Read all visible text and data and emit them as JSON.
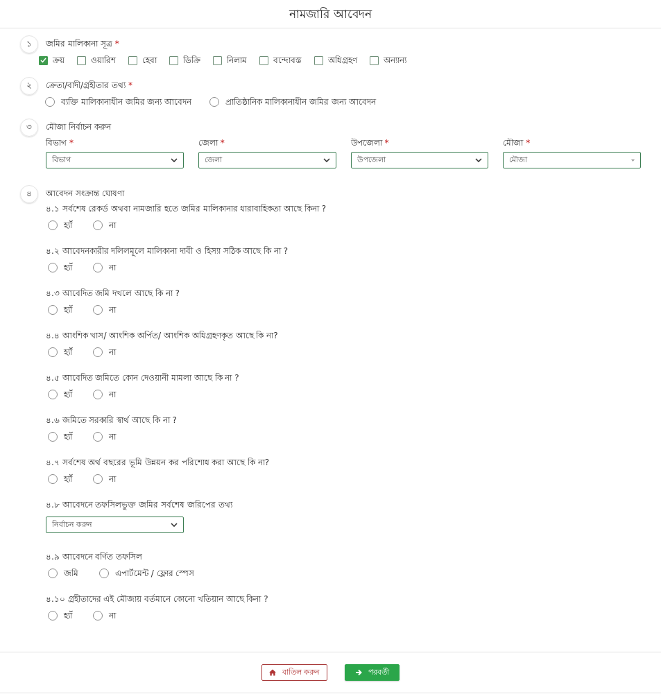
{
  "header": {
    "title": "নামজারি আবেদন"
  },
  "sections": [
    {
      "number": "১",
      "kind": "checkboxes",
      "label": "জমির মালিকানা সূত্র",
      "required_mark": "*",
      "options": [
        {
          "label": "ক্রয়",
          "checked": true
        },
        {
          "label": "ওয়ারিশ",
          "checked": false
        },
        {
          "label": "হেবা",
          "checked": false
        },
        {
          "label": "ডিক্রি",
          "checked": false
        },
        {
          "label": "নিলাম",
          "checked": false
        },
        {
          "label": "বন্দোবস্ত",
          "checked": false
        },
        {
          "label": "অধিগ্রহণ",
          "checked": false
        },
        {
          "label": "অন্যান্য",
          "checked": false
        }
      ]
    },
    {
      "number": "২",
      "kind": "radios",
      "label": "ক্রেতা/বাদী/গ্রহীতার তথ্য",
      "required_mark": "*",
      "options": [
        {
          "label": "ব্যক্তি মালিকানাধীন জমির জন্য আবেদন",
          "selected": false
        },
        {
          "label": "প্রাতিষ্ঠানিক মালিকানাধীন জমির জন্য আবেদন",
          "selected": false
        }
      ]
    },
    {
      "number": "৩",
      "kind": "selects",
      "label": "মৌজা নির্বাচন করুন",
      "fields": [
        {
          "kind": "dropdown",
          "label": "বিভাগ",
          "required_mark": "*",
          "placeholder": "বিভাগ"
        },
        {
          "kind": "dropdown",
          "label": "জেলা",
          "required_mark": "*",
          "placeholder": "জেলা"
        },
        {
          "kind": "dropdown",
          "label": "উপজেলা",
          "required_mark": "*",
          "placeholder": "উপজেলা"
        },
        {
          "kind": "combobox",
          "label": "মৌজা",
          "required_mark": "*",
          "placeholder": "মৌজা"
        }
      ]
    },
    {
      "number": "৪",
      "kind": "questions",
      "label": "আবেদন সংক্রান্ত ঘোষণা",
      "questions": [
        {
          "kind": "radios",
          "text": "৪.১ সর্বশেষ রেকর্ড অথবা নামজারি হতে জমির মালিকানার ধারাবাহিকতা আছে কিনা ?",
          "options": [
            {
              "label": "হ্যাঁ",
              "selected": false
            },
            {
              "label": "না",
              "selected": false
            }
          ]
        },
        {
          "kind": "radios",
          "text": "৪.২ আবেদনকারীর দলিলমূলে মালিকানা দাবী ও হিস্যা সঠিক আছে কি না ?",
          "options": [
            {
              "label": "হ্যাঁ",
              "selected": false
            },
            {
              "label": "না",
              "selected": false
            }
          ]
        },
        {
          "kind": "radios",
          "text": "৪.৩ আবেদিত জমি দখলে আছে কি না ?",
          "options": [
            {
              "label": "হ্যাঁ",
              "selected": false
            },
            {
              "label": "না",
              "selected": false
            }
          ]
        },
        {
          "kind": "radios",
          "text": "৪.৪ আংশিক খাস/ আংশিক অর্পিত/ আংশিক অধিগ্রহণকৃত আছে কি না?",
          "options": [
            {
              "label": "হ্যাঁ",
              "selected": false
            },
            {
              "label": "না",
              "selected": false
            }
          ]
        },
        {
          "kind": "radios",
          "text": "৪.৫ আবেদিত জমিতে কোন দেওয়ানী মামলা আছে কি না ?",
          "options": [
            {
              "label": "হ্যাঁ",
              "selected": false
            },
            {
              "label": "না",
              "selected": false
            }
          ]
        },
        {
          "kind": "radios",
          "text": "৪.৬ জমিতে সরকারি স্বার্থ আছে কি না ?",
          "options": [
            {
              "label": "হ্যাঁ",
              "selected": false
            },
            {
              "label": "না",
              "selected": false
            }
          ]
        },
        {
          "kind": "radios",
          "text": "৪.৭ সর্বশেষ অর্থ বছরের ভূমি উন্নয়ন কর পরিশোধ করা আছে কি না?",
          "options": [
            {
              "label": "হ্যাঁ",
              "selected": false
            },
            {
              "label": "না",
              "selected": false
            }
          ]
        },
        {
          "kind": "select",
          "text": "৪.৮ আবেদনে তফসিলভুক্ত জমির সর্বশেষ জরিপের তথ্য",
          "placeholder": "নির্বাচন করুন"
        },
        {
          "kind": "radios",
          "text": "৪.৯ আবেদনে বর্ণিত তফসিল",
          "options": [
            {
              "label": "জমি",
              "selected": false
            },
            {
              "label": "এপার্টমেন্ট / ফ্লোর স্পেস",
              "selected": false
            }
          ]
        },
        {
          "kind": "radios",
          "text": "৪.১০ গ্রহীতাদের এই মৌজায় বর্তমানে কোনো খতিয়ান আছে কিনা ?",
          "options": [
            {
              "label": "হ্যাঁ",
              "selected": false
            },
            {
              "label": "না",
              "selected": false
            }
          ]
        }
      ]
    }
  ],
  "actions": [
    {
      "kind": "cancel",
      "label": "বাতিল করুন"
    },
    {
      "kind": "next",
      "label": "পরবর্তী"
    }
  ]
}
